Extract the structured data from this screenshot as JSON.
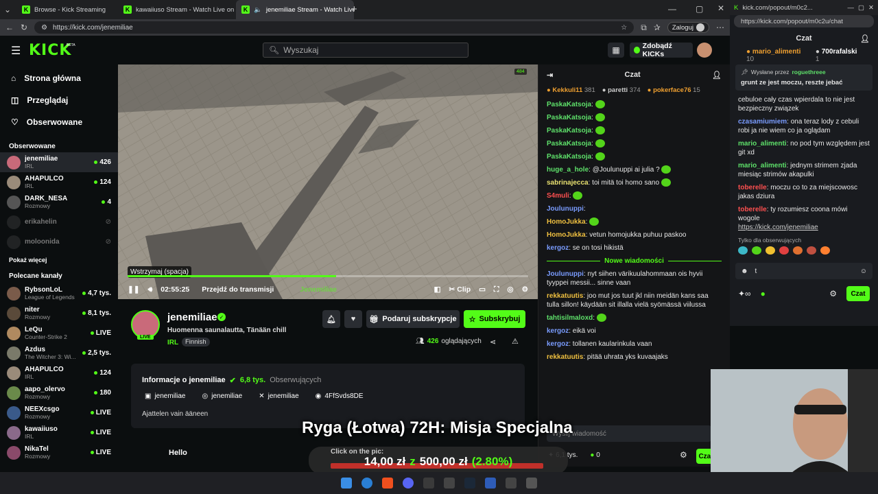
{
  "browser": {
    "tabs": [
      {
        "title": "Browse - Kick Streaming"
      },
      {
        "title": "kawaiiuso Stream - Watch Live on"
      },
      {
        "title": "jenemiliae Stream - Watch Live on"
      }
    ],
    "url": "https://kick.com/jenemiliae",
    "signin": "Zaloguj"
  },
  "header": {
    "logo": "KICK",
    "logo_beta": "BETA",
    "search_placeholder": "Wyszukaj",
    "kicks_button": "Zdobądź KICKs"
  },
  "sidebar": {
    "nav": [
      {
        "label": "Strona główna",
        "icon": "home-icon"
      },
      {
        "label": "Przeglądaj",
        "icon": "browse-icon"
      },
      {
        "label": "Obserwowane",
        "icon": "heart-icon"
      }
    ],
    "followed_title": "Obserwowane",
    "followed": [
      {
        "name": "jenemiliae",
        "category": "IRL",
        "viewers": "426",
        "color": "#c96a7a"
      },
      {
        "name": "AHAPULCO",
        "category": "IRL",
        "viewers": "124",
        "color": "#9a8b7a"
      },
      {
        "name": "DARK_NESA",
        "category": "Rozmowy",
        "viewers": "4",
        "color": "#555"
      },
      {
        "name": "erikahelin",
        "category": "",
        "viewers": "",
        "color": "#444"
      },
      {
        "name": "moloonida",
        "category": "",
        "viewers": "",
        "color": "#444"
      }
    ],
    "show_more": "Pokaż więcej",
    "recommended_title": "Polecane kanały",
    "recommended": [
      {
        "name": "RybsonLoL",
        "category": "League of Legends",
        "viewers": "4,7 tys.",
        "color": "#7a5b4a"
      },
      {
        "name": "niter",
        "category": "Rozmowy",
        "viewers": "8,1 tys.",
        "color": "#5a4a3a"
      },
      {
        "name": "LeQu",
        "category": "Counter-Strike 2",
        "viewers": "LIVE",
        "color": "#b08a60"
      },
      {
        "name": "Azdus",
        "category": "The Witcher 3: Wi...",
        "viewers": "2,5 tys.",
        "color": "#7a7a6a"
      },
      {
        "name": "AHAPULCO",
        "category": "IRL",
        "viewers": "124",
        "color": "#9a8b7a"
      },
      {
        "name": "aapo_olervo",
        "category": "Rozmowy",
        "viewers": "180",
        "color": "#6a8a4a"
      },
      {
        "name": "NEEXcsgo",
        "category": "Rozmowy",
        "viewers": "LIVE",
        "color": "#3a5a8a"
      },
      {
        "name": "kawaiiuso",
        "category": "IRL",
        "viewers": "LIVE",
        "color": "#8a6a8a"
      },
      {
        "name": "NikaTel",
        "category": "Rozmowy",
        "viewers": "LIVE",
        "color": "#8a4a6a"
      }
    ]
  },
  "player": {
    "viewer_badge": "484",
    "tooltip": "Wstrzymaj (spacja)",
    "time": "02:55:25",
    "go_live": "Przejdź do transmisji",
    "watermark": "Jenemiliae",
    "clip": "Clip",
    "progress": 0.52
  },
  "channel": {
    "name": "jenemiliae",
    "live_badge": "LIVE",
    "title": "Huomenna saunalautta, Tänään chill",
    "category": "IRL",
    "language": "Finnish",
    "gift_button": "Podaruj subskrypcje",
    "subscribe_button": "Subskrybuj",
    "viewers": "426",
    "viewers_label": "oglądających",
    "about_title": "Informacje o jenemiliae",
    "followers": "6,8 tys.",
    "followers_label": "Obserwujących",
    "socials": [
      {
        "icon": "kick-icon",
        "label": "jenemiliae"
      },
      {
        "icon": "instagram-icon",
        "label": "jenemiliae"
      },
      {
        "icon": "x-icon",
        "label": "jenemiliae"
      },
      {
        "icon": "discord-icon",
        "label": "4FfSvds8DE"
      }
    ],
    "bio": "Ajattelen vain ääneen",
    "hello": "Hello"
  },
  "chat": {
    "title": "Czat",
    "top_gifters": [
      {
        "name": "Kekkuli11",
        "count": "381",
        "color": "#f0a030"
      },
      {
        "name": "paretti",
        "count": "374",
        "color": "#cccccc"
      },
      {
        "name": "pokerface76",
        "count": "15",
        "color": "#f0a030"
      }
    ],
    "messages": [
      {
        "user": "PaskaKatsoja",
        "text": "",
        "color": "#5ee06a",
        "emote": true
      },
      {
        "user": "PaskaKatsoja",
        "text": "",
        "color": "#5ee06a",
        "emote": true
      },
      {
        "user": "PaskaKatsoja",
        "text": "",
        "color": "#5ee06a",
        "emote": true
      },
      {
        "user": "PaskaKatsoja",
        "text": "",
        "color": "#5ee06a",
        "emote": true
      },
      {
        "user": "PaskaKatsoja",
        "text": "",
        "color": "#5ee06a",
        "emote": true
      },
      {
        "user": "huge_a_hole",
        "text": "@Joulunuppi ai julia ?",
        "color": "#5ee06a",
        "emote": true
      },
      {
        "user": "sabrinajecca",
        "text": "toi mitä toi homo sano",
        "color": "#e8e070",
        "emote": true
      },
      {
        "user": "S4muli",
        "text": "",
        "color": "#ff5050",
        "emote": true
      },
      {
        "user": "Joulunuppi",
        "text": "",
        "color": "#7a9cff",
        "emote": false
      },
      {
        "user": "HomoJukka",
        "text": "",
        "color": "#f0c040",
        "emote": true
      },
      {
        "user": "HomoJukka",
        "text": "vetun homojukka puhuu paskoo",
        "color": "#f0c040",
        "emote": false
      },
      {
        "user": "kergoz",
        "text": "se on tosi hikistä",
        "color": "#7a9cff",
        "emote": false
      }
    ],
    "new_messages": "Nowe wiadomości",
    "messages_after": [
      {
        "user": "Joulunuppi",
        "text": "nyt siihen värikuulahommaan ois hyvii tyyppei messii... sinne vaan",
        "color": "#7a9cff"
      },
      {
        "user": "rekkatuutis",
        "text": "joo mut jos tuut jkl niin meidän kans saa tulla sillon! käydään sit illalla vielä syömässä viilussa",
        "color": "#f0c040"
      },
      {
        "user": "tahtisilmaloxd",
        "text": "",
        "color": "#5ee06a"
      },
      {
        "user": "kergoz",
        "text": "eikä voi",
        "color": "#7a9cff"
      },
      {
        "user": "kergoz",
        "text": "tollanen kaularinkula vaan",
        "color": "#7a9cff"
      },
      {
        "user": "rekkatuutis",
        "text": "pitää uhrata yks kuvaajaks",
        "color": "#f0c040"
      }
    ],
    "input_placeholder": "Wyślij wiadomość",
    "points": "6,1 tys.",
    "points2": "0",
    "send": "Czat"
  },
  "popout": {
    "url_title": "kick.com/popout/m0c2...",
    "url": "https://kick.com/popout/m0c2u/chat",
    "title": "Czat",
    "gifters": [
      {
        "name": "mario_alimenti",
        "count": "10"
      },
      {
        "name": "700rafalski",
        "count": "1"
      }
    ],
    "pinned_by": "Wysłane przez",
    "pinned_user": "roguethreee",
    "pinned_text": "grunt ze jest moczu, reszte jebać",
    "messages": [
      {
        "user": "",
        "text": "cebuloe cały czas wpierdala to nie jest bezpieczny związek",
        "color": "#e8e8e8"
      },
      {
        "user": "czasamiumiem",
        "text": "ona teraz lody z cebuli robi ja nie wiem co ja oglądam",
        "color": "#7a9cff"
      },
      {
        "user": "mario_alimenti",
        "text": "no pod tym względem jest git xd",
        "color": "#5ee06a"
      },
      {
        "user": "mario_alimenti",
        "text": "jednym strimem zjada miesiąc strimów akapulki",
        "color": "#5ee06a"
      },
      {
        "user": "toberelle",
        "text": "moczu co to za miejscowosc jakas dziura",
        "color": "#ff5050"
      },
      {
        "user": "toberelle",
        "text": "ty rozumiesz coona mówi wogole",
        "color": "#ff5050"
      }
    ],
    "link": "https://kick.com/jenemiliae",
    "followers_only": "Tylko dla obserwujących",
    "input_value": "t",
    "send": "Czat"
  },
  "overlay": {
    "title": "Ryga (Łotwa) 72H: Misja Specjalna",
    "click": "Click on the pic:",
    "goal": "14,00 zł",
    "z": "z",
    "target": "500,00 zł",
    "percent": "(2.80%)"
  }
}
